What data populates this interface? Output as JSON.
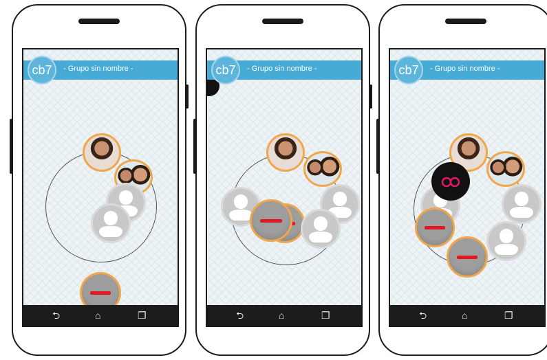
{
  "screens": [
    {
      "badge": "cb7",
      "title": "- Grupo sin nombre -"
    },
    {
      "badge": "cb7",
      "title": "- Grupo sin nombre -"
    },
    {
      "badge": "cb7",
      "title": "- Grupo sin nombre -"
    }
  ],
  "icons": {
    "back": "back-icon",
    "home": "home-icon",
    "recents": "recents-icon",
    "minus": "minus-icon",
    "link": "link-icon"
  },
  "colors": {
    "header": "#47abd6",
    "accent_ring": "#f0a64a",
    "remove": "#e0181f",
    "link": "#e0186b",
    "navbar": "#1c1c1c"
  }
}
